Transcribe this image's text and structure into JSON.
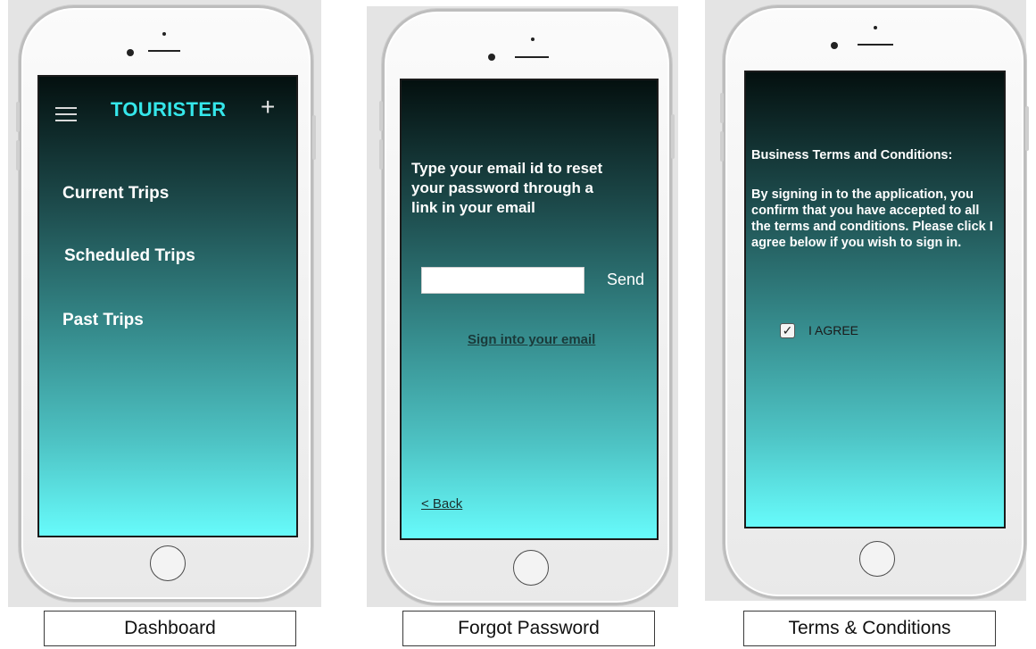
{
  "screens": [
    {
      "caption": "Dashboard",
      "header": {
        "title": "TOURISTER",
        "menu_icon": "hamburger-icon",
        "add_icon": "plus-icon"
      },
      "nav_items": [
        "Current Trips",
        "Scheduled Trips",
        "Past Trips"
      ]
    },
    {
      "caption": "Forgot Password",
      "instructions": "Type your email id to reset your password through a link in your email",
      "email_input": {
        "value": "",
        "placeholder": ""
      },
      "send_label": "Send",
      "sign_in_link": "Sign into your email",
      "back_link": "< Back"
    },
    {
      "caption": "Terms & Conditions",
      "heading": "Business Terms and Conditions:",
      "body": "By signing in to the application, you confirm that you have accepted to all the terms and conditions. Please click I agree below if you wish to sign in.",
      "agree": {
        "label": "I AGREE",
        "checked": true,
        "check_glyph": "✓"
      }
    }
  ],
  "colors": {
    "title_accent": "#35e6ea",
    "screen_gradient_top": "#04100f",
    "screen_gradient_bottom": "#67fbfb"
  }
}
